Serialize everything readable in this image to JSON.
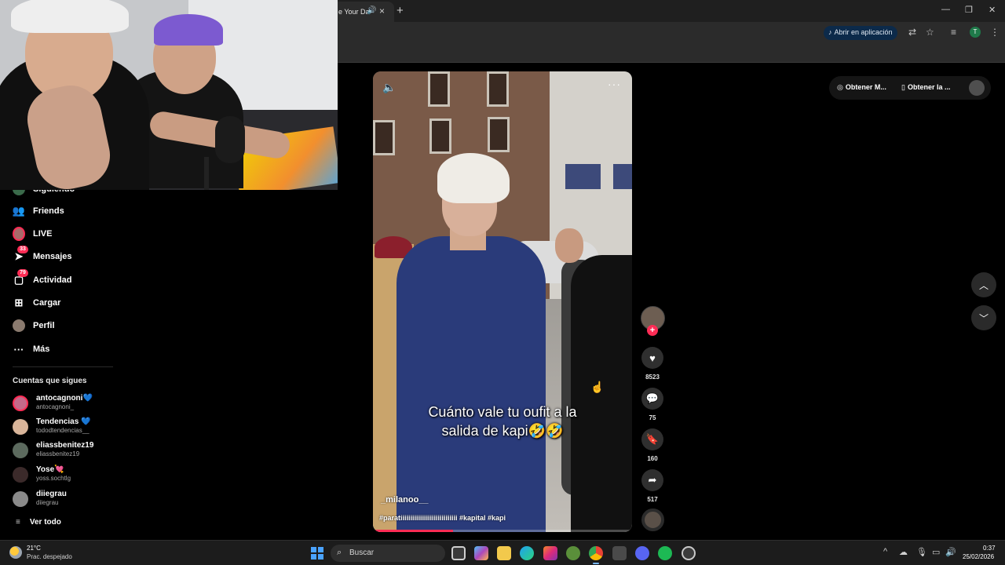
{
  "browser": {
    "tab_title": "e Your Da",
    "open_app_label": "Abrir en aplicación",
    "profile_initial": "T"
  },
  "sidebar": {
    "partial_item_label": "Siguiendo",
    "items": [
      {
        "label": "Friends",
        "icon": "friends-icon"
      },
      {
        "label": "LIVE",
        "icon": "live-avatar"
      },
      {
        "label": "Mensajes",
        "icon": "messages-icon",
        "badge": "33"
      },
      {
        "label": "Actividad",
        "icon": "activity-icon",
        "badge": "79"
      },
      {
        "label": "Cargar",
        "icon": "upload-icon"
      },
      {
        "label": "Perfil",
        "icon": "profile-avatar"
      },
      {
        "label": "Más",
        "icon": "more-icon"
      }
    ],
    "following_heading": "Cuentas que sigues",
    "following": [
      {
        "name": "antocagnoni💙",
        "user": "antocagnoni_"
      },
      {
        "name": "Tendencias 💙",
        "user": "tododtendencias__"
      },
      {
        "name": "eliassbenitez19",
        "user": "eliassbenitez19"
      },
      {
        "name": "Yose💘",
        "user": "yoss.sochtlg"
      },
      {
        "name": "diiegrau",
        "user": "diiegrau"
      }
    ],
    "see_all": "Ver todo"
  },
  "video": {
    "caption_line1": "Cuánto vale tu oufit a la",
    "caption_line2": "salida de kapi🤣🤣",
    "author": "_milanoo__",
    "tags": "#paratiiiiiiiiiiiiiiiiiiiiiiiiiiiii #kapital #kapi",
    "progress": 0.31
  },
  "actions": {
    "likes": "8523",
    "comments": "75",
    "saves": "160",
    "shares": "517"
  },
  "top_right": {
    "btn1": "Obtener M...",
    "btn2": "Obtener la ..."
  },
  "taskbar": {
    "temperature": "21°C",
    "weather": "Prac. despejado",
    "search_placeholder": "Buscar",
    "time": "0:37",
    "date": "25/02/2026"
  },
  "colors": {
    "accent": "#fe2c55",
    "background": "#000000",
    "windows_blue": "#4aa3ff"
  }
}
